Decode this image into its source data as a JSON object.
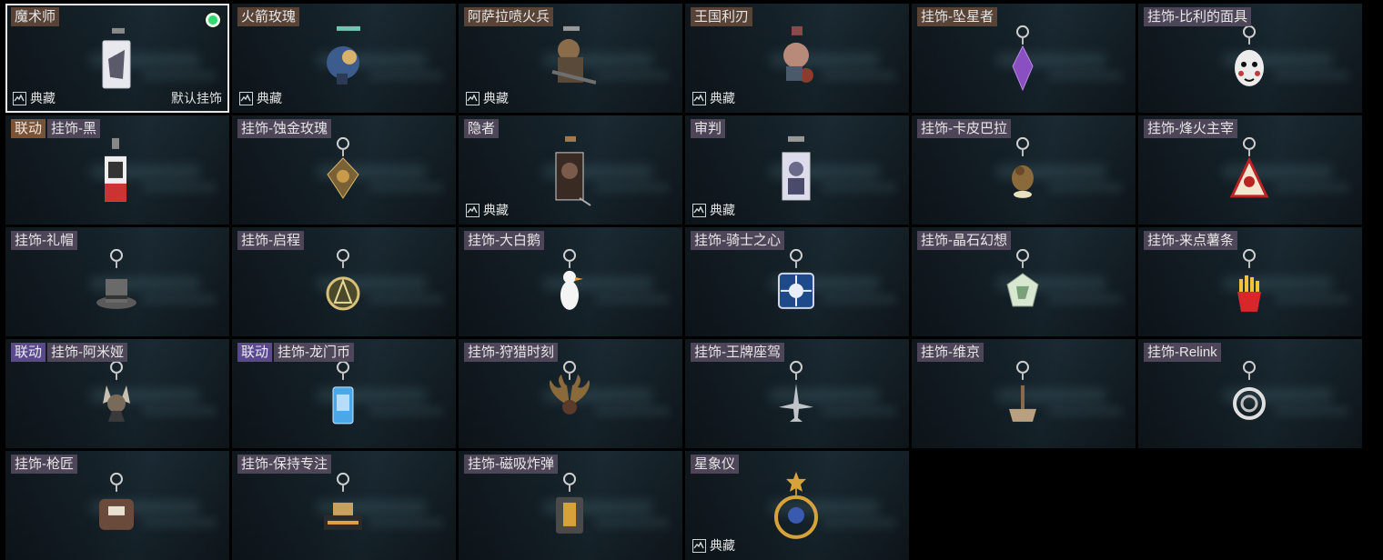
{
  "items": [
    {
      "label": "魔术师",
      "collab": "",
      "collab_color": "",
      "label_style": "brown",
      "collection": "典藏",
      "default": "默认挂饰",
      "selected": true,
      "equipped": true,
      "icon": "magician-card-charm-icon"
    },
    {
      "label": "火箭玫瑰",
      "collab": "",
      "collab_color": "",
      "label_style": "brown",
      "collection": "典藏",
      "default": "",
      "selected": false,
      "equipped": false,
      "icon": "rocket-rose-charm-icon"
    },
    {
      "label": "阿萨拉喷火兵",
      "collab": "",
      "collab_color": "",
      "label_style": "brown",
      "collection": "典藏",
      "default": "",
      "selected": false,
      "equipped": false,
      "icon": "flamethrower-soldier-charm-icon"
    },
    {
      "label": "王国利刃",
      "collab": "",
      "collab_color": "",
      "label_style": "brown",
      "collection": "典藏",
      "default": "",
      "selected": false,
      "equipped": false,
      "icon": "kingdom-blade-charm-icon"
    },
    {
      "label": "挂饰-坠星者",
      "collab": "",
      "collab_color": "",
      "label_style": "brown",
      "collection": "",
      "default": "",
      "selected": false,
      "equipped": false,
      "icon": "purple-crystal-charm-icon"
    },
    {
      "label": "挂饰-比利的面具",
      "collab": "",
      "collab_color": "",
      "label_style": "purple",
      "collection": "",
      "default": "",
      "selected": false,
      "equipped": false,
      "icon": "billy-mask-charm-icon"
    },
    {
      "label": "挂饰-黑",
      "collab": "联动",
      "collab_color": "brown",
      "label_style": "purple",
      "collection": "",
      "default": "",
      "selected": false,
      "equipped": false,
      "icon": "black-card-charm-icon"
    },
    {
      "label": "挂饰-蚀金玫瑰",
      "collab": "",
      "collab_color": "",
      "label_style": "purple",
      "collection": "",
      "default": "",
      "selected": false,
      "equipped": false,
      "icon": "gold-rose-emblem-charm-icon"
    },
    {
      "label": "隐者",
      "collab": "",
      "collab_color": "",
      "label_style": "purple",
      "collection": "典藏",
      "default": "",
      "selected": false,
      "equipped": false,
      "icon": "hermit-card-charm-icon"
    },
    {
      "label": "审判",
      "collab": "",
      "collab_color": "",
      "label_style": "purple",
      "collection": "典藏",
      "default": "",
      "selected": false,
      "equipped": false,
      "icon": "judgement-card-charm-icon"
    },
    {
      "label": "挂饰-卡皮巴拉",
      "collab": "",
      "collab_color": "",
      "label_style": "purple",
      "collection": "",
      "default": "",
      "selected": false,
      "equipped": false,
      "icon": "capybara-charm-icon"
    },
    {
      "label": "挂饰-烽火主宰",
      "collab": "",
      "collab_color": "",
      "label_style": "purple",
      "collection": "",
      "default": "",
      "selected": false,
      "equipped": false,
      "icon": "triangle-emblem-charm-icon"
    },
    {
      "label": "挂饰-礼帽",
      "collab": "",
      "collab_color": "",
      "label_style": "purple",
      "collection": "",
      "default": "",
      "selected": false,
      "equipped": false,
      "icon": "top-hat-charm-icon"
    },
    {
      "label": "挂饰-启程",
      "collab": "",
      "collab_color": "",
      "label_style": "purple",
      "collection": "",
      "default": "",
      "selected": false,
      "equipped": false,
      "icon": "compass-medal-charm-icon"
    },
    {
      "label": "挂饰-大白鹅",
      "collab": "",
      "collab_color": "",
      "label_style": "purple",
      "collection": "",
      "default": "",
      "selected": false,
      "equipped": false,
      "icon": "white-goose-charm-icon"
    },
    {
      "label": "挂饰-骑士之心",
      "collab": "",
      "collab_color": "",
      "label_style": "purple",
      "collection": "",
      "default": "",
      "selected": false,
      "equipped": false,
      "icon": "knight-heart-charm-icon"
    },
    {
      "label": "挂饰-晶石幻想",
      "collab": "",
      "collab_color": "",
      "label_style": "purple",
      "collection": "",
      "default": "",
      "selected": false,
      "equipped": false,
      "icon": "crystal-cube-charm-icon"
    },
    {
      "label": "挂饰-来点薯条",
      "collab": "",
      "collab_color": "",
      "label_style": "purple",
      "collection": "",
      "default": "",
      "selected": false,
      "equipped": false,
      "icon": "fries-charm-icon"
    },
    {
      "label": "挂饰-阿米娅",
      "collab": "联动",
      "collab_color": "purple",
      "label_style": "purple",
      "collection": "",
      "default": "",
      "selected": false,
      "equipped": false,
      "icon": "amiya-charm-icon"
    },
    {
      "label": "挂饰-龙门币",
      "collab": "联动",
      "collab_color": "purple",
      "label_style": "purple",
      "collection": "",
      "default": "",
      "selected": false,
      "equipped": false,
      "icon": "lungmen-coin-charm-icon"
    },
    {
      "label": "挂饰-狩猎时刻",
      "collab": "",
      "collab_color": "",
      "label_style": "purple",
      "collection": "",
      "default": "",
      "selected": false,
      "equipped": false,
      "icon": "antlers-charm-icon"
    },
    {
      "label": "挂饰-王牌座驾",
      "collab": "",
      "collab_color": "",
      "label_style": "purple",
      "collection": "",
      "default": "",
      "selected": false,
      "equipped": false,
      "icon": "jet-plane-charm-icon"
    },
    {
      "label": "挂饰-维京",
      "collab": "",
      "collab_color": "",
      "label_style": "purple",
      "collection": "",
      "default": "",
      "selected": false,
      "equipped": false,
      "icon": "viking-hammer-charm-icon"
    },
    {
      "label": "挂饰-Relink",
      "collab": "",
      "collab_color": "",
      "label_style": "purple",
      "collection": "",
      "default": "",
      "selected": false,
      "equipped": false,
      "icon": "relink-knot-charm-icon"
    },
    {
      "label": "挂饰-枪匠",
      "collab": "",
      "collab_color": "",
      "label_style": "purple",
      "collection": "",
      "default": "",
      "selected": false,
      "equipped": false,
      "icon": "gunsmith-bag-charm-icon"
    },
    {
      "label": "挂饰-保持专注",
      "collab": "",
      "collab_color": "",
      "label_style": "purple",
      "collection": "",
      "default": "",
      "selected": false,
      "equipped": false,
      "icon": "stay-focused-tag-charm-icon"
    },
    {
      "label": "挂饰-磁吸炸弹",
      "collab": "",
      "collab_color": "",
      "label_style": "purple",
      "collection": "",
      "default": "",
      "selected": false,
      "equipped": false,
      "icon": "magnet-bomb-charm-icon"
    },
    {
      "label": "星象仪",
      "collab": "",
      "collab_color": "",
      "label_style": "purple",
      "collection": "典藏",
      "default": "",
      "selected": false,
      "equipped": false,
      "icon": "astrolabe-charm-icon"
    }
  ]
}
